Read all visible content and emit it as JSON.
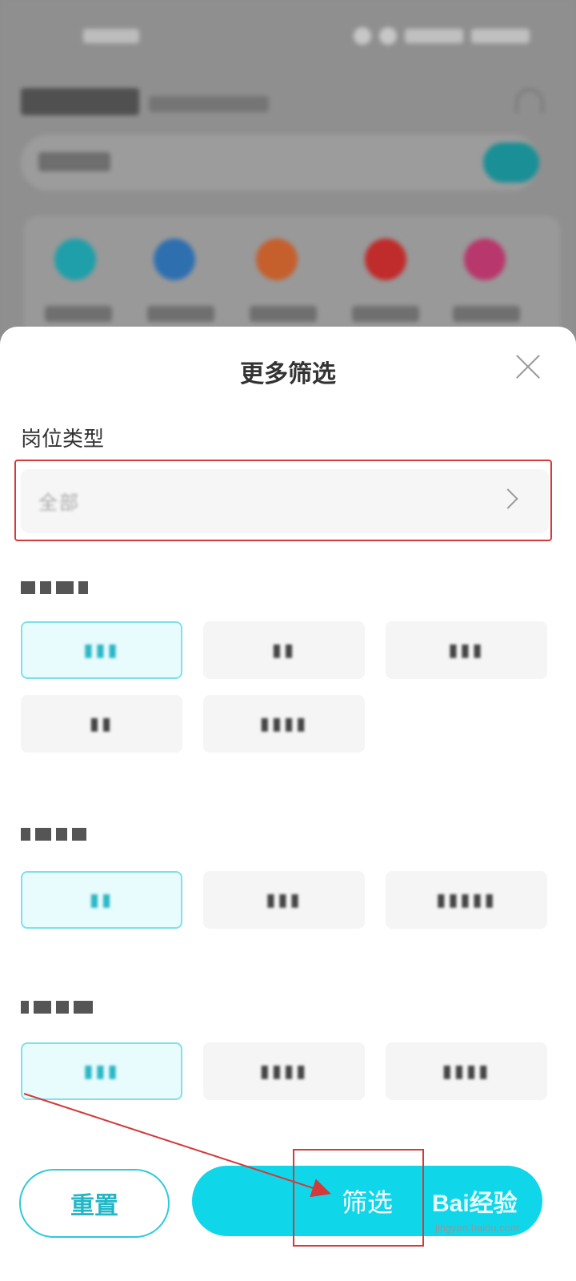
{
  "sheet": {
    "title": "更多筛选",
    "position_type_label": "岗位类型",
    "position_type_value": "全部"
  },
  "buttons": {
    "reset_label": "重置",
    "filter_label": "筛选"
  },
  "watermark": {
    "brand": "Bai经验",
    "url": "jingyan.baidu.com"
  },
  "colors": {
    "accent": "#10d6ea",
    "accent_text": "#23b7c6",
    "annotation": "#d33a3a"
  }
}
